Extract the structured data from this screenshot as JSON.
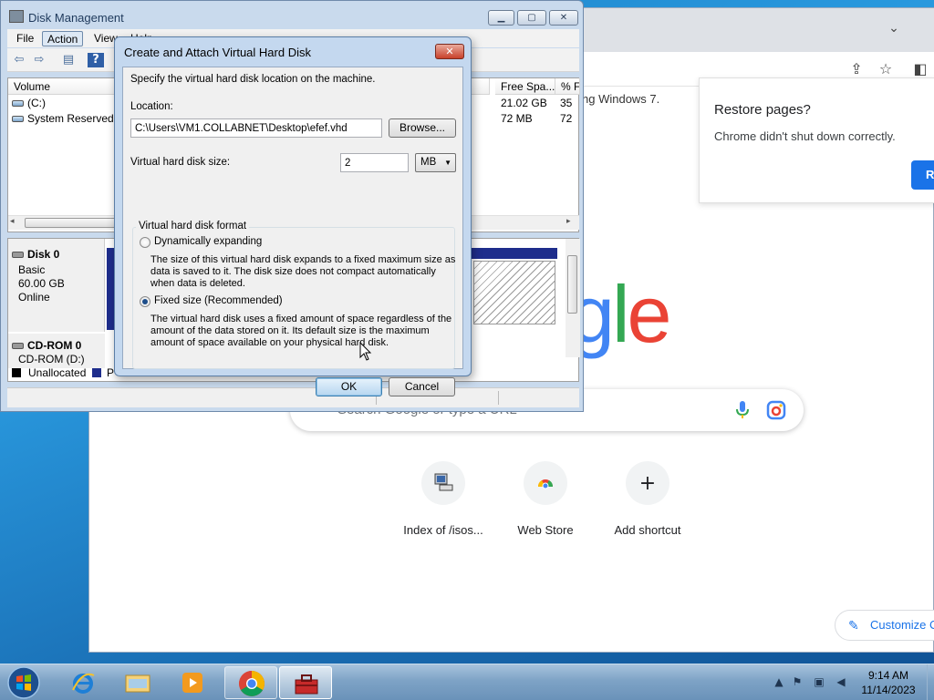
{
  "chrome": {
    "tab_snippet": "ng Windows 7.",
    "restore": {
      "title": "Restore pages?",
      "message": "Chrome didn't shut down correctly.",
      "button": "R"
    },
    "logo": [
      "g",
      "l",
      "e"
    ],
    "logo_colors": [
      "#4285f4",
      "#34a853",
      "#ea4335"
    ],
    "search_placeholder": "Search Google or type a URL",
    "shortcuts": [
      {
        "label": "Index of /isos...",
        "icon": "computer-icon"
      },
      {
        "label": "Web Store",
        "icon": "chrome-web-store-icon"
      },
      {
        "label": "Add shortcut",
        "icon": "plus-icon",
        "glyph": "+"
      }
    ],
    "customize_label": "Customize C"
  },
  "disk_mgmt": {
    "title": "Disk Management",
    "menu": [
      "File",
      "Action",
      "View",
      "Help"
    ],
    "columns": {
      "volume": "Volume",
      "free_space": "Free Spa...",
      "pct_free": "% F"
    },
    "volumes": [
      {
        "name": "(C:)",
        "free": "21.02 GB",
        "pct": "35"
      },
      {
        "name": "System Reserved",
        "free": "72 MB",
        "pct": "72"
      }
    ],
    "disk0": {
      "name": "Disk 0",
      "type": "Basic",
      "size": "60.00 GB",
      "status": "Online"
    },
    "cdrom": {
      "name": "CD-ROM 0",
      "drive": "CD-ROM (D:)"
    },
    "legend": {
      "unallocated": "Unallocated",
      "primary": "P"
    }
  },
  "dialog": {
    "title": "Create and Attach Virtual Hard Disk",
    "instruction": "Specify the virtual hard disk location on the machine.",
    "location_label": "Location:",
    "location_value": "C:\\Users\\VM1.COLLABNET\\Desktop\\efef.vhd",
    "browse": "Browse...",
    "size_label": "Virtual hard disk size:",
    "size_value": "2",
    "size_unit": "MB",
    "format_group": "Virtual hard disk format",
    "dynamic_label": "Dynamically expanding",
    "dynamic_desc": [
      "The size of this virtual hard disk expands to a fixed maximum size as",
      "data is saved to it.  The disk size does not compact automatically",
      "when data is deleted."
    ],
    "fixed_label": "Fixed size (Recommended)",
    "fixed_desc": [
      "The virtual hard disk uses a fixed amount of space regardless of the",
      "amount of the data stored on it.  Its default size is the maximum",
      "amount of space available on your physical hard disk."
    ],
    "selected_format": "fixed",
    "ok": "OK",
    "cancel": "Cancel"
  },
  "taskbar": {
    "time": "9:14 AM",
    "date": "11/14/2023",
    "apps": [
      "internet-explorer-icon",
      "windows-explorer-icon",
      "media-player-icon",
      "chrome-icon",
      "toolbox-icon"
    ]
  }
}
